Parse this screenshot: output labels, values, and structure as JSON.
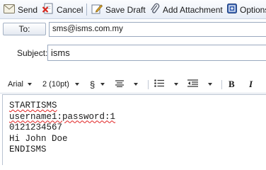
{
  "toolbar": {
    "send_label": "Send",
    "cancel_label": "Cancel",
    "save_draft_label": "Save Draft",
    "add_attachment_label": "Add Attachment",
    "options_label": "Options"
  },
  "address": {
    "to_button_label": "To:",
    "to_value": "sms@isms.com.my",
    "subject_label": "Subject:",
    "subject_value": "isms"
  },
  "format_bar": {
    "font_name": "Arial",
    "font_size": "2 (10pt)",
    "style_symbol": "§",
    "bold_label": "B",
    "italic_label": "I"
  },
  "body": {
    "lines": [
      "STARTISMS",
      "username1:password:1",
      "0121234567",
      "Hi John Doe",
      "ENDISMS"
    ]
  },
  "icons": {
    "send": "envelope-icon",
    "cancel": "document-delete-icon",
    "save_draft": "pencil-paper-icon",
    "add_attachment": "paperclip-icon",
    "options": "options-icon",
    "align": "align-icon",
    "bullets": "bullet-list-icon",
    "outdent": "outdent-icon"
  },
  "colors": {
    "toolbar_bg": "#e8eef7",
    "spellcheck_underline": "#e02020",
    "cancel_red": "#d8261c"
  }
}
